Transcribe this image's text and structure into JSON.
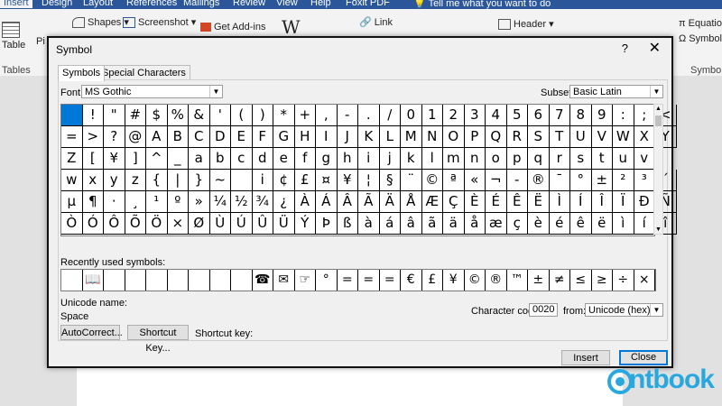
{
  "ribbon": {
    "tabs": [
      "Insert",
      "Design",
      "Layout",
      "References",
      "Mailings",
      "Review",
      "View",
      "Help",
      "Foxit PDF"
    ],
    "tell_me": "Tell me what you want to do",
    "table_label": "Table",
    "tables_group": "Tables",
    "shapes": "Shapes",
    "screenshot": "Screenshot",
    "get_addins": "Get Add-ins",
    "link": "Link",
    "header": "Header",
    "equation": "Equation",
    "symbol": "Symbol",
    "symbols_group": "Symbols",
    "pi_partial": "Pi"
  },
  "dialog": {
    "title": "Symbol",
    "help": "?",
    "close_glyph": "✕",
    "tabs": [
      "Symbols",
      "Special Characters"
    ],
    "font_label": "Font:",
    "font_value": "MS Gothic",
    "subset_label": "Subset:",
    "subset_value": "Basic Latin",
    "symbols": [
      [
        " ",
        "!",
        "\"",
        "#",
        "$",
        "%",
        "&",
        "'",
        "(",
        ")",
        "*",
        "+",
        ",",
        "-",
        ".",
        "/",
        "0",
        "1",
        "2",
        "3",
        "4",
        "5",
        "6",
        "7",
        "8",
        "9",
        ":",
        ";",
        "<"
      ],
      [
        "=",
        ">",
        "?",
        "@",
        "A",
        "B",
        "C",
        "D",
        "E",
        "F",
        "G",
        "H",
        "I",
        "J",
        "K",
        "L",
        "M",
        "N",
        "O",
        "P",
        "Q",
        "R",
        "S",
        "T",
        "U",
        "V",
        "W",
        "X",
        "Y"
      ],
      [
        "Z",
        "[",
        "¥",
        "]",
        "^",
        "_",
        "a",
        "b",
        "c",
        "d",
        "e",
        "f",
        "g",
        "h",
        "i",
        "j",
        "k",
        "l",
        "m",
        "n",
        "o",
        "p",
        "q",
        "r",
        "s",
        "t",
        "u",
        "v"
      ],
      [
        "w",
        "x",
        "y",
        "z",
        "{",
        "|",
        "}",
        "~",
        " ",
        "i",
        "¢",
        "£",
        "¤",
        "¥",
        "¦",
        "§",
        "¨",
        "©",
        "ª",
        "«",
        "¬",
        "-",
        "®",
        "¯",
        "°",
        "±",
        "²",
        "³",
        "´"
      ],
      [
        "µ",
        "¶",
        "·",
        "¸",
        "¹",
        "º",
        "»",
        "¼",
        "½",
        "¾",
        "¿",
        "À",
        "Á",
        "Â",
        "Ã",
        "Ä",
        "Å",
        "Æ",
        "Ç",
        "È",
        "É",
        "Ê",
        "Ë",
        "Ì",
        "Í",
        "Î",
        "Ï",
        "Ð",
        "Ñ"
      ],
      [
        "Ò",
        "Ó",
        "Ô",
        "Õ",
        "Ö",
        "×",
        "Ø",
        "Ù",
        "Ú",
        "Û",
        "Ü",
        "Ý",
        "Þ",
        "ß",
        "à",
        "á",
        "â",
        "ã",
        "ä",
        "å",
        "æ",
        "ç",
        "è",
        "é",
        "ê",
        "ë",
        "ì",
        "í",
        "î"
      ]
    ],
    "recent_label": "Recently used symbols:",
    "recent": [
      "",
      "📖",
      "",
      "",
      "",
      "",
      "",
      "",
      "",
      "☎",
      "✉",
      "☞",
      "°",
      "=",
      "=",
      "=",
      "€",
      "£",
      "¥",
      "©",
      "®",
      "™",
      "±",
      "≠",
      "≤",
      "≥",
      "÷",
      "×"
    ],
    "unicode_name_label": "Unicode name:",
    "unicode_name_value": "Space",
    "autocorrect": "AutoCorrect...",
    "shortcut_key_button": "Shortcut Key...",
    "shortcut_key_label": "Shortcut key:",
    "char_code_label": "Character code:",
    "char_code_value": "0020",
    "from_label": "from:",
    "from_value": "Unicode (hex)",
    "insert": "Insert",
    "close": "Close"
  },
  "watermark": "ntbook",
  "colors": {
    "accent": "#0078d7",
    "ribbon": "#2b579a",
    "watermark": "#29a8e0"
  }
}
